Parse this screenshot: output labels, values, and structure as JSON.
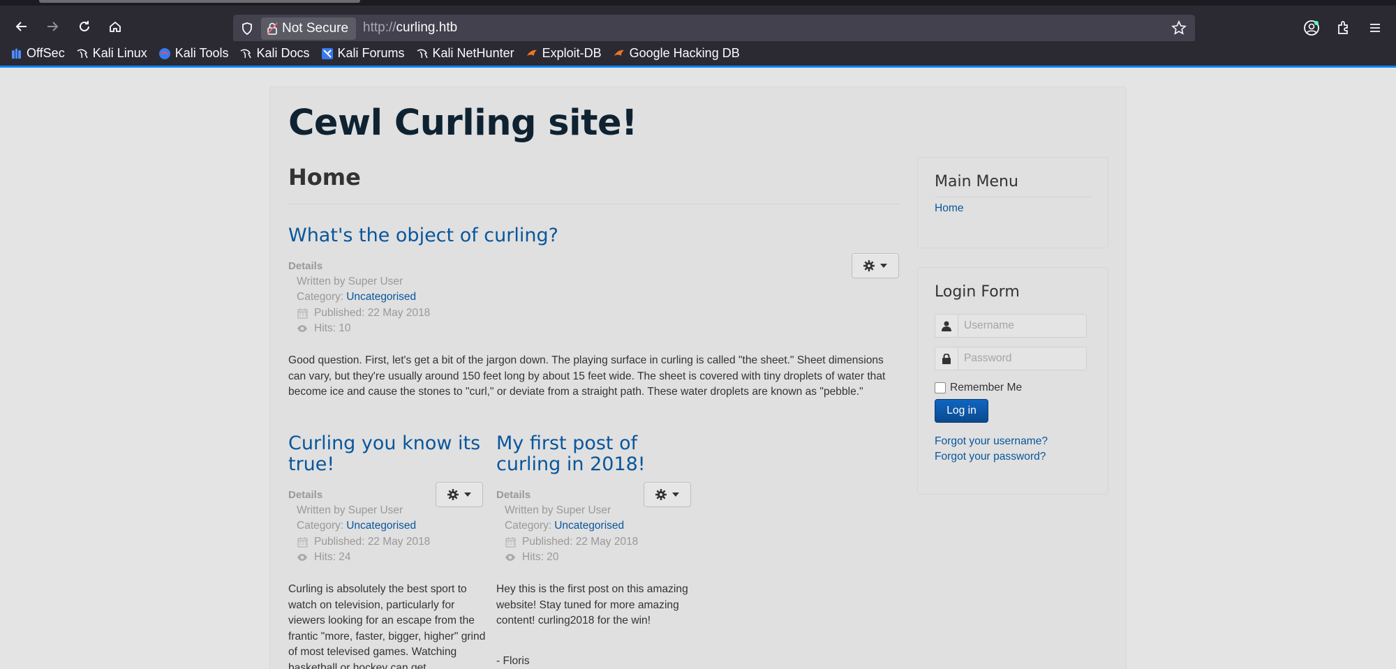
{
  "browser": {
    "security_label": "Not Secure",
    "url_protocol": "http://",
    "url_host": "curling.htb",
    "bookmarks": [
      {
        "label": "OffSec",
        "icon": "offsec-icon"
      },
      {
        "label": "Kali Linux",
        "icon": "kali-dragon-icon"
      },
      {
        "label": "Kali Tools",
        "icon": "kali-tools-icon"
      },
      {
        "label": "Kali Docs",
        "icon": "kali-dragon-icon"
      },
      {
        "label": "Kali Forums",
        "icon": "kali-forums-icon"
      },
      {
        "label": "Kali NetHunter",
        "icon": "kali-dragon-icon"
      },
      {
        "label": "Exploit-DB",
        "icon": "exploit-db-icon"
      },
      {
        "label": "Google Hacking DB",
        "icon": "exploit-db-icon"
      }
    ]
  },
  "site": {
    "title": "Cewl Curling site!",
    "page_heading": "Home",
    "details_label": "Details",
    "written_by": "Written by Super User",
    "category_prefix": "Category:",
    "category": "Uncategorised"
  },
  "articles": [
    {
      "title": "What's the object of curling?",
      "published": "Published: 22 May 2018",
      "hits": "Hits: 10",
      "body": "Good question. First, let's get a bit of the jargon down. The playing surface in curling is called \"the sheet.\" Sheet dimensions can vary, but they're usually around 150 feet long by about 15 feet wide. The sheet is covered with tiny droplets of water that become ice and cause the stones to \"curl,\" or deviate from a straight path. These water droplets are known as \"pebble.\""
    },
    {
      "title_line1": "Curling you know its",
      "title_line2": "true!",
      "published": "Published: 22 May 2018",
      "hits": "Hits: 24",
      "body": "Curling is absolutely the best sport to watch on television, particularly for viewers looking for an escape from the frantic \"more, faster, bigger, higher\" grind of most televised games. Watching basketball or hockey can get"
    },
    {
      "title_line1": "My first post of",
      "title_line2": "curling in 2018!",
      "published": "Published: 22 May 2018",
      "hits": "Hits: 20",
      "body": "Hey this is the first post on this amazing website! Stay tuned for more amazing content! curling2018 for the win!",
      "signature": "- Floris"
    }
  ],
  "main_menu": {
    "title": "Main Menu",
    "items": [
      "Home"
    ]
  },
  "login_form": {
    "title": "Login Form",
    "username_placeholder": "Username",
    "password_placeholder": "Password",
    "remember_label": "Remember Me",
    "login_button": "Log in",
    "forgot_username": "Forgot your username?",
    "forgot_password": "Forgot your password?"
  },
  "colors": {
    "link": "#08569b",
    "title": "#0f2231",
    "chrome": "#2b2a33",
    "accent": "#0a84ff"
  }
}
